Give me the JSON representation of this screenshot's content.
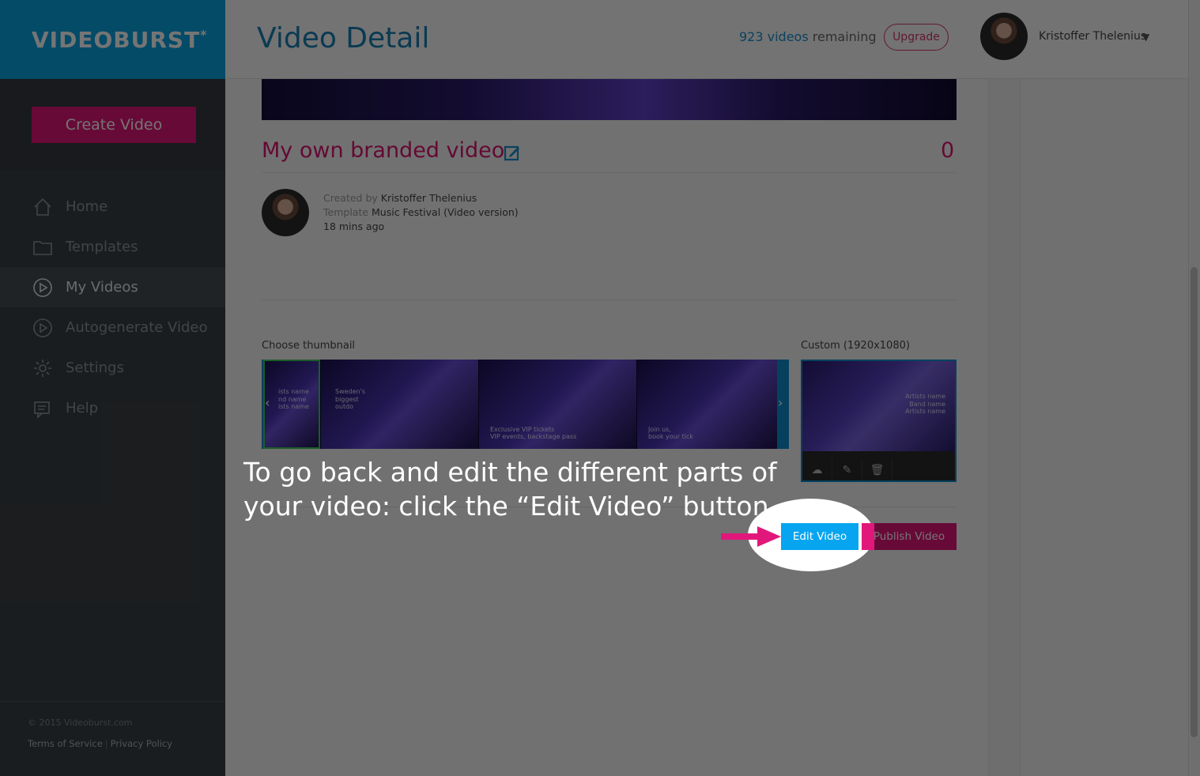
{
  "brand": {
    "logo": "VIDEOBURST",
    "logo_star": "*",
    "accent": "#0aa4e3",
    "pink": "#e2177b"
  },
  "sidebar": {
    "create_label": "Create Video",
    "items": [
      {
        "label": "Home",
        "icon": "home-icon"
      },
      {
        "label": "Templates",
        "icon": "folder-icon"
      },
      {
        "label": "My Videos",
        "icon": "play-icon",
        "active": true
      },
      {
        "label": "Autogenerate Video",
        "icon": "play-icon"
      },
      {
        "label": "Settings",
        "icon": "gear-icon"
      },
      {
        "label": "Help",
        "icon": "help-icon"
      }
    ],
    "copyright": "© 2015 Videoburst.com",
    "terms": "Terms of Service",
    "privacy": "Privacy Policy"
  },
  "header": {
    "title": "Video Detail",
    "remaining_count": "923 videos",
    "remaining_suffix": " remaining",
    "upgrade_label": "Upgrade",
    "user_name": "Kristoffer Thelenius"
  },
  "video": {
    "title": "My own branded video",
    "views": "0",
    "created_by_label": "Created by ",
    "created_by": "Kristoffer Thelenius",
    "template_label": "Template ",
    "template": "Music Festival (Video version)",
    "age": "18 mins ago"
  },
  "thumbnails": {
    "choose_label": "Choose thumbnail",
    "custom_label": "Custom (1920x1080)",
    "items": [
      {
        "text": "ists name\nnd name\nists name"
      },
      {
        "text": "Sweden's\nbiggest\noutdo"
      },
      {
        "text": "Exclusive VIP tickets\nVIP events, backstage pass"
      },
      {
        "text": "Join us,\nbook your tick"
      }
    ],
    "custom_text": "Artists name\nBand name\nArtists name"
  },
  "actions": {
    "edit_label": "Edit Video",
    "publish_label": "Publish Video"
  },
  "tutorial": {
    "text": "To go back and edit the different parts of your video: click the “Edit Video” button."
  }
}
